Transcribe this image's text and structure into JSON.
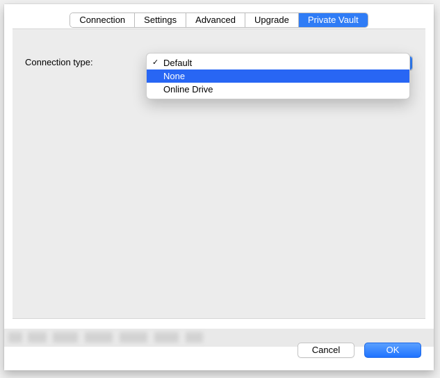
{
  "tabs": [
    {
      "label": "Connection",
      "active": false
    },
    {
      "label": "Settings",
      "active": false
    },
    {
      "label": "Advanced",
      "active": false
    },
    {
      "label": "Upgrade",
      "active": false
    },
    {
      "label": "Private Vault",
      "active": true
    }
  ],
  "form": {
    "connection_type_label": "Connection type:"
  },
  "dropdown": {
    "options": [
      {
        "label": "Default",
        "selected": true,
        "highlighted": false
      },
      {
        "label": "None",
        "selected": false,
        "highlighted": true
      },
      {
        "label": "Online Drive",
        "selected": false,
        "highlighted": false
      }
    ]
  },
  "buttons": {
    "cancel": "Cancel",
    "ok": "OK"
  }
}
